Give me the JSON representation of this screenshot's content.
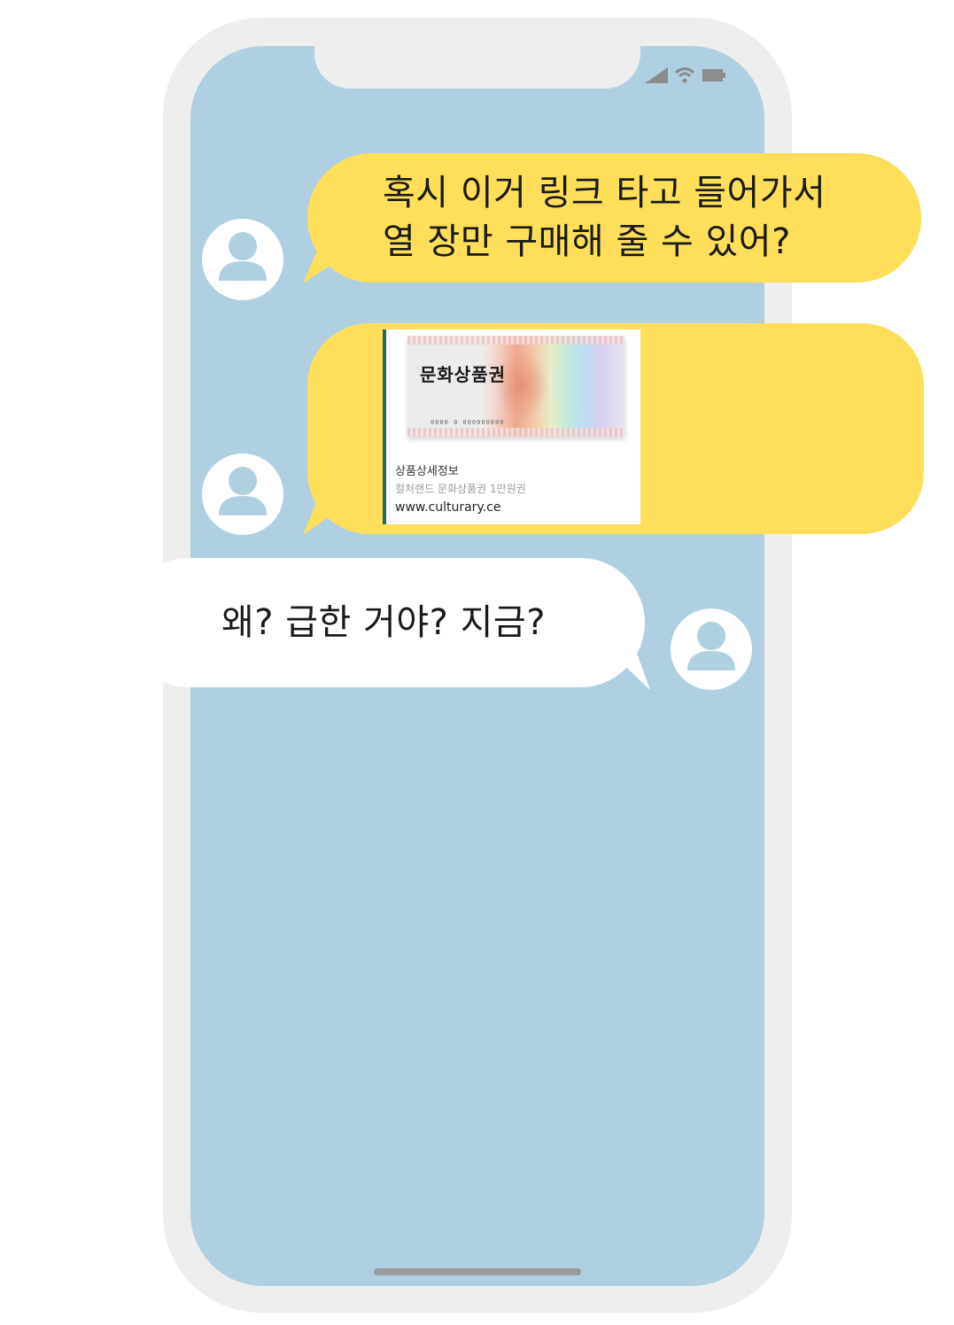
{
  "messages": [
    {
      "sender": "other",
      "text_line1": "혹시 이거 링크 타고 들어가서",
      "text_line2": "열 장만 구매해 줄 수 있어?"
    },
    {
      "sender": "other",
      "card": {
        "image_label": "문화상품권",
        "serial": "0000 0 000000000",
        "info_title": "상품상세정보",
        "info_desc": "컬처랜드 문화상품권 1만원권",
        "url": "www.culturary.ce"
      }
    },
    {
      "sender": "me",
      "text": "왜? 급한 거야? 지금?"
    }
  ],
  "icons": {
    "status": [
      "cellular-signal-icon",
      "wifi-icon",
      "battery-icon"
    ],
    "avatar": "person-icon"
  },
  "colors": {
    "screen_background": "#b0d0e1",
    "phone_frame": "#eeeeee",
    "incoming_bubble": "#ffde5a",
    "outgoing_bubble": "#ffffff",
    "avatar_figure": "#b0d0e1",
    "card_accent": "#1f6e63"
  }
}
